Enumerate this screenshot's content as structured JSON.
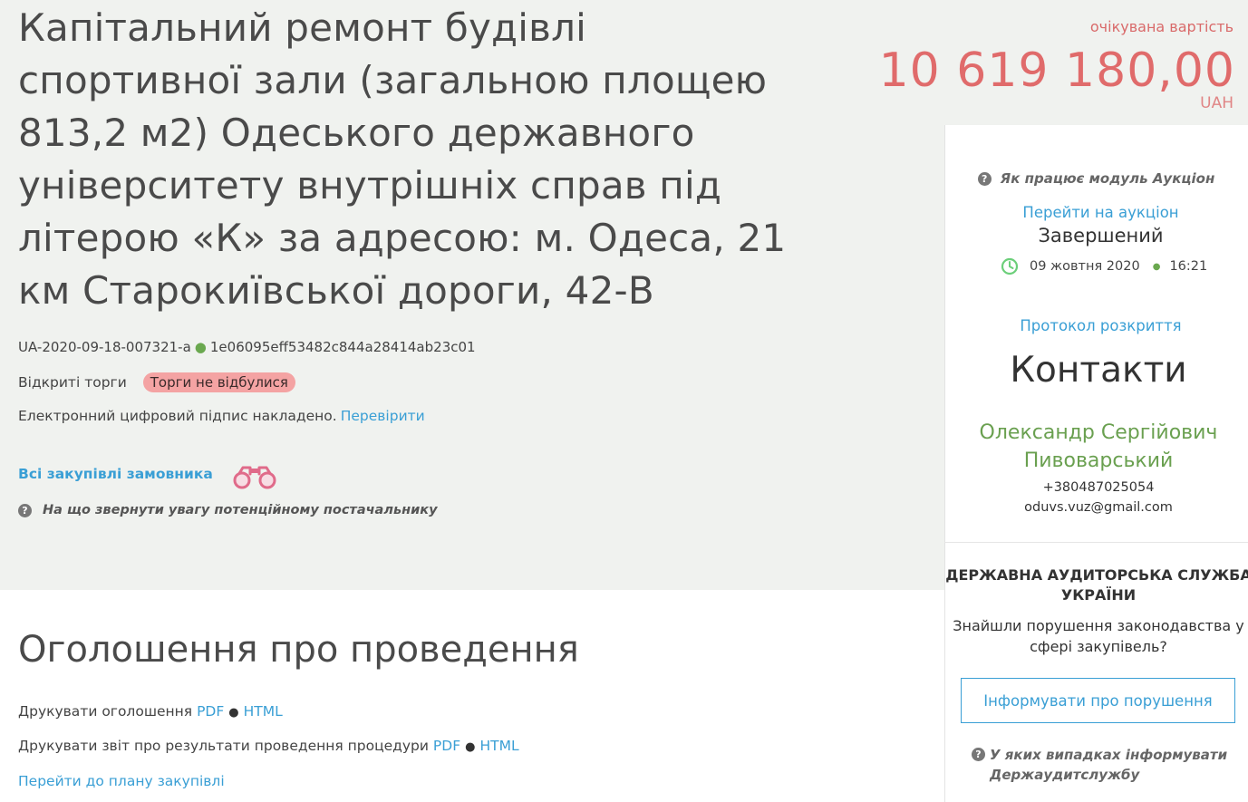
{
  "tender": {
    "title": "Капітальний ремонт будівлі спортивної зали (загальною площею 813,2 м2) Одеського державного університету внутрішніх справ під літерою «К» за адресою: м. Одеса, 21 км Старокиївськoї дороги, 42-В",
    "id": "UA-2020-09-18-007321-a",
    "hash": "1e06095eff53482c844a28414ab23c01",
    "type": "Відкриті торги",
    "status_badge": "Торги не відбулися",
    "signature_text": "Електронний цифровий підпис накладено.",
    "verify_link": "Перевірити",
    "all_purchases_link": "Всі закупівлі замовника",
    "supplier_hint": "На що звернути увагу потенційному постачальнику"
  },
  "cost": {
    "label": "очікувана вартість",
    "value": "10 619 180,00",
    "currency": "UAH"
  },
  "auction": {
    "how_it_works": "Як працює модуль Аукціон",
    "goto_link": "Перейти на аукціон",
    "status": "Завершений",
    "date": "09 жовтня 2020",
    "time": "16:21"
  },
  "sidebar": {
    "protocol_link": "Протокол розкриття",
    "contacts_title": "Контакти",
    "contact_name": "Олександр Сергійович Пивоварський",
    "contact_phone": "+380487025054",
    "contact_email": "oduvs.vuz@gmail.com"
  },
  "audit": {
    "title": "ДЕРЖАВНА АУДИТОРСЬКА СЛУЖБА УКРАЇНИ",
    "text": "Знайшли порушення законодавства у сфері закупівель?",
    "button": "Інформувати про порушення",
    "hint": "У яких випадках інформувати Держаудитслужбу"
  },
  "announcement": {
    "title": "Оголошення про проведення",
    "print_notice": "Друкувати оголошення",
    "print_report": "Друкувати звіт про результати проведення процедури",
    "pdf": "PDF",
    "html": "HTML",
    "plan_link": "Перейти до плану закупівлі"
  },
  "icons": {
    "question": "question-circle-icon",
    "clock": "clock-icon",
    "binoculars": "binoculars-icon"
  },
  "colors": {
    "accent_link": "#3a9fd5",
    "cost_red": "#e06b6b",
    "badge_bg": "#f4a3a3",
    "contact_green": "#6aa050",
    "top_band_bg": "#f0f2ef"
  }
}
